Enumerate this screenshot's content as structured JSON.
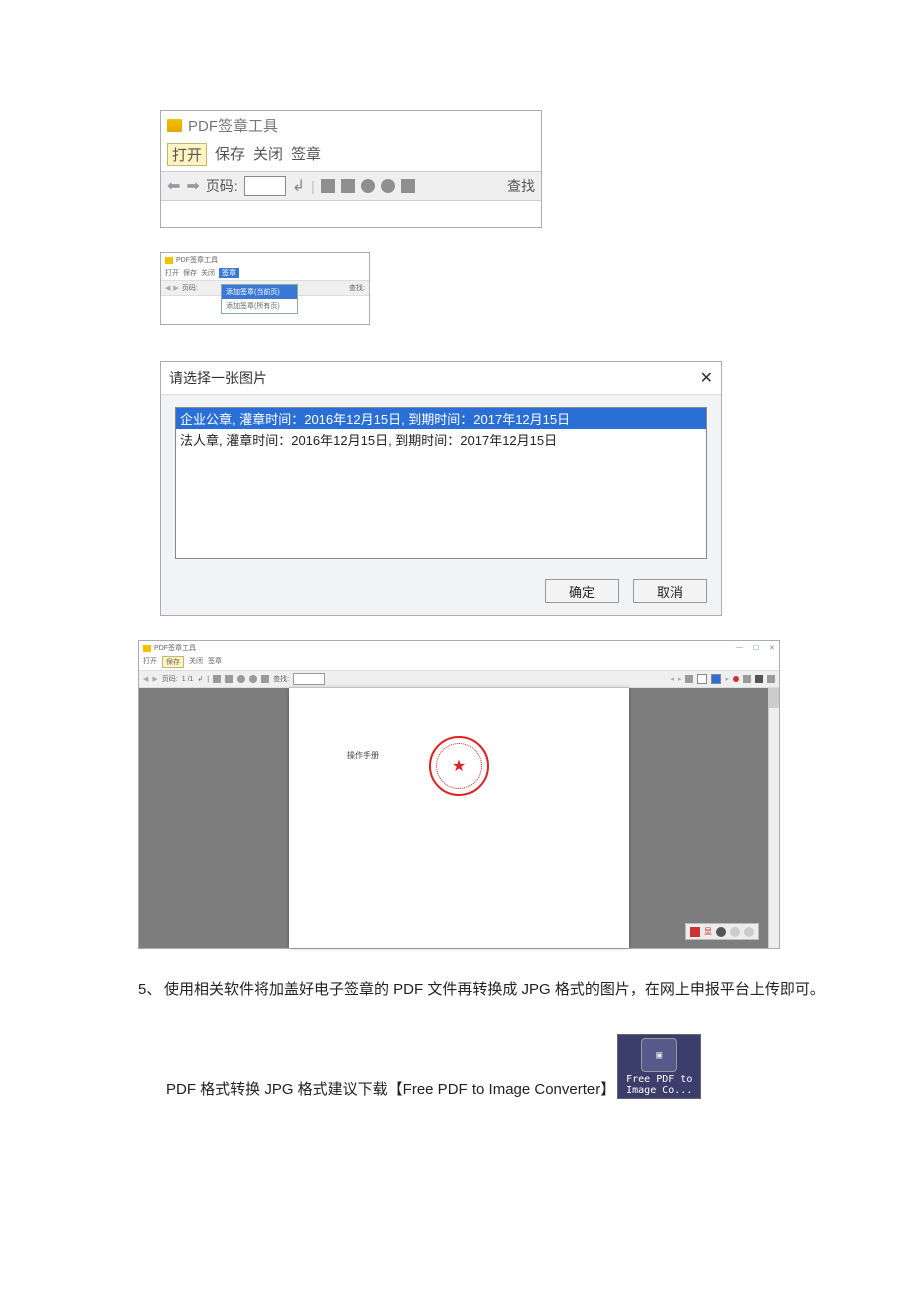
{
  "ss1": {
    "title": "PDF签章工具",
    "menu": {
      "open": "打开",
      "save": "保存",
      "close": "关闭",
      "sign": "签章"
    },
    "toolbar": {
      "page_label": "页码:",
      "find": "查找"
    }
  },
  "ss2": {
    "title": "PDF签章工具",
    "menu": {
      "open": "打开",
      "save": "保存",
      "close": "关闭",
      "sign": "签章"
    },
    "toolbar": {
      "page_label": "页码:",
      "find": "查找:"
    },
    "dropdown": {
      "item1": "添加签章(当前页)",
      "item2": "添加签章(所有页)"
    }
  },
  "ss3": {
    "title": "请选择一张图片",
    "list": {
      "row1": "企业公章, 灌章时间：2016年12月15日, 到期时间：2017年12月15日",
      "row2": "法人章, 灌章时间：2016年12月15日, 到期时间：2017年12月15日"
    },
    "buttons": {
      "ok": "确定",
      "cancel": "取消"
    }
  },
  "ss4": {
    "title": "PDF签章工具",
    "menu": {
      "open": "打开",
      "save": "保存",
      "close": "关闭",
      "sign": "签章"
    },
    "toolbar": {
      "page_label": "页码:",
      "pagecount": "1 /1",
      "find": "查找:"
    },
    "doc_label": "操作手册",
    "overlay_text": "显"
  },
  "body": {
    "step5_num": "5、",
    "step5_text": "使用相关软件将加盖好电子签章的 PDF 文件再转换成 JPG 格式的图片，在网上申报平台上传即可。",
    "converter_text": "PDF 格式转换 JPG 格式建议下载【Free PDF to Image Converter】",
    "icon_line1": "Free PDF to",
    "icon_line2": "Image Co..."
  }
}
